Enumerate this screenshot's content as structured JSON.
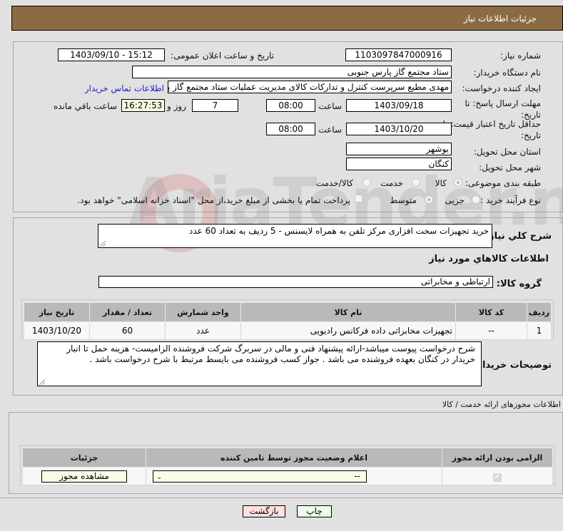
{
  "header": {
    "title": "جزئیات اطلاعات نیاز"
  },
  "fields": {
    "need_number_label": "شماره نیاز:",
    "need_number": "1103097847000916",
    "announce_label": "تاریخ و ساعت اعلان عمومی:",
    "announce_value": "1403/09/10 - 15:12",
    "buyer_org_label": "نام دستگاه خریدار:",
    "buyer_org": "ستاد مجتمع گاز پارس جنوبی",
    "creator_label": "ایجاد کننده درخواست:",
    "creator": "مهدی مطیع سرپرست کنترل و تدارکات کالای مدیریت عملیات ستاد مجتمع گاز پا",
    "contact_link": "اطلاعات تماس خریدار",
    "deadline_label": "مهلت ارسال پاسخ: تا تاریخ:",
    "deadline_date": "1403/09/18",
    "time_label": "ساعت",
    "deadline_time": "08:00",
    "days_value": "7",
    "days_label": "روز و",
    "remaining_time": "16:27:53",
    "remaining_label": "ساعت باقي مانده",
    "validity_label": "حداقل تاریخ اعتبار قیمت: تا تاریخ:",
    "validity_date": "1403/10/20",
    "validity_time": "08:00",
    "province_label": "استان محل تحویل:",
    "province": "بوشهر",
    "city_label": "شهر محل تحویل:",
    "city": "کنگان",
    "category_label": "طبقه بندی موضوعی:",
    "category_options": [
      "کالا",
      "خدمت",
      "کالا/خدمت"
    ],
    "category_selected": "کالا",
    "process_label": "نوع فرآیند خرید :",
    "process_options": [
      "جزیی",
      "متوسط"
    ],
    "process_selected": "متوسط",
    "treasury_note": "پرداخت تمام یا بخشی از مبلغ خرید،از محل \"اسناد خزانه اسلامی\" خواهد بود."
  },
  "description": {
    "label": "شرح کلي نياز:",
    "value": "خرید تجهیزات سخت افزاری مرکز تلفن  به همراه لایسنس - 5 ردیف به تعداد 60 عدد"
  },
  "goods": {
    "section_title": "اطلاعات کالاهاي مورد نياز",
    "group_label": "گروه کالا:",
    "group_value": "ارتباطی و مخابراتی",
    "columns": [
      "ردیف",
      "کد کالا",
      "نام کالا",
      "واحد شمارش",
      "تعداد / مقدار",
      "تاریخ نیاز"
    ],
    "rows": [
      [
        "1",
        "--",
        "تجهیزات مخابراتی داده فرکانس رادیویی",
        "عدد",
        "60",
        "1403/10/20"
      ]
    ]
  },
  "buyer_notes": {
    "label": "توضیحات خریدار:",
    "value": "شرح درخواست پیوست میباشد-ارائه پیشنهاد فنی و مالی در سربرگ شرکت فروشنده الزامیست- هزینه حمل  تا انبار خریدار در کنگان بعهده فروشنده می باشد . جواز کسب فروشنده می بایسط مرتبط با شرح درخواست باشد ."
  },
  "permits": {
    "section_title": "اطلاعات مجوزهای ارائه خدمت / کالا",
    "columns": [
      "الزامی بودن ارائه مجوز",
      "اعلام وضعیت مجوز توسط تامین کننده",
      "جزئیات"
    ],
    "row": {
      "required_checked": true,
      "status_select": "--",
      "details_button": "مشاهده مجوز"
    }
  },
  "actions": {
    "print": "چاپ",
    "back": "بازگشت"
  },
  "watermark": "AriaTender.net"
}
